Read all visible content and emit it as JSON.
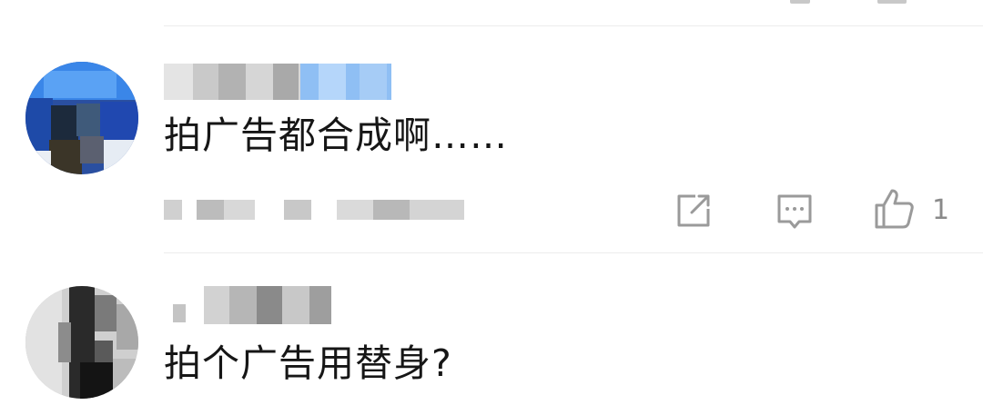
{
  "comments": [
    {
      "text": "拍广告都合成啊……",
      "actions": {
        "share_icon": "share-icon",
        "reply_icon": "reply-icon",
        "like_icon": "thumbs-up-icon",
        "like_count": "1"
      }
    },
    {
      "text": "拍个广告用替身?"
    }
  ],
  "colors": {
    "text": "#161616",
    "icon": "#9a9a9a",
    "divider": "#ececec",
    "mosaic_blue": "#4a90f0"
  }
}
